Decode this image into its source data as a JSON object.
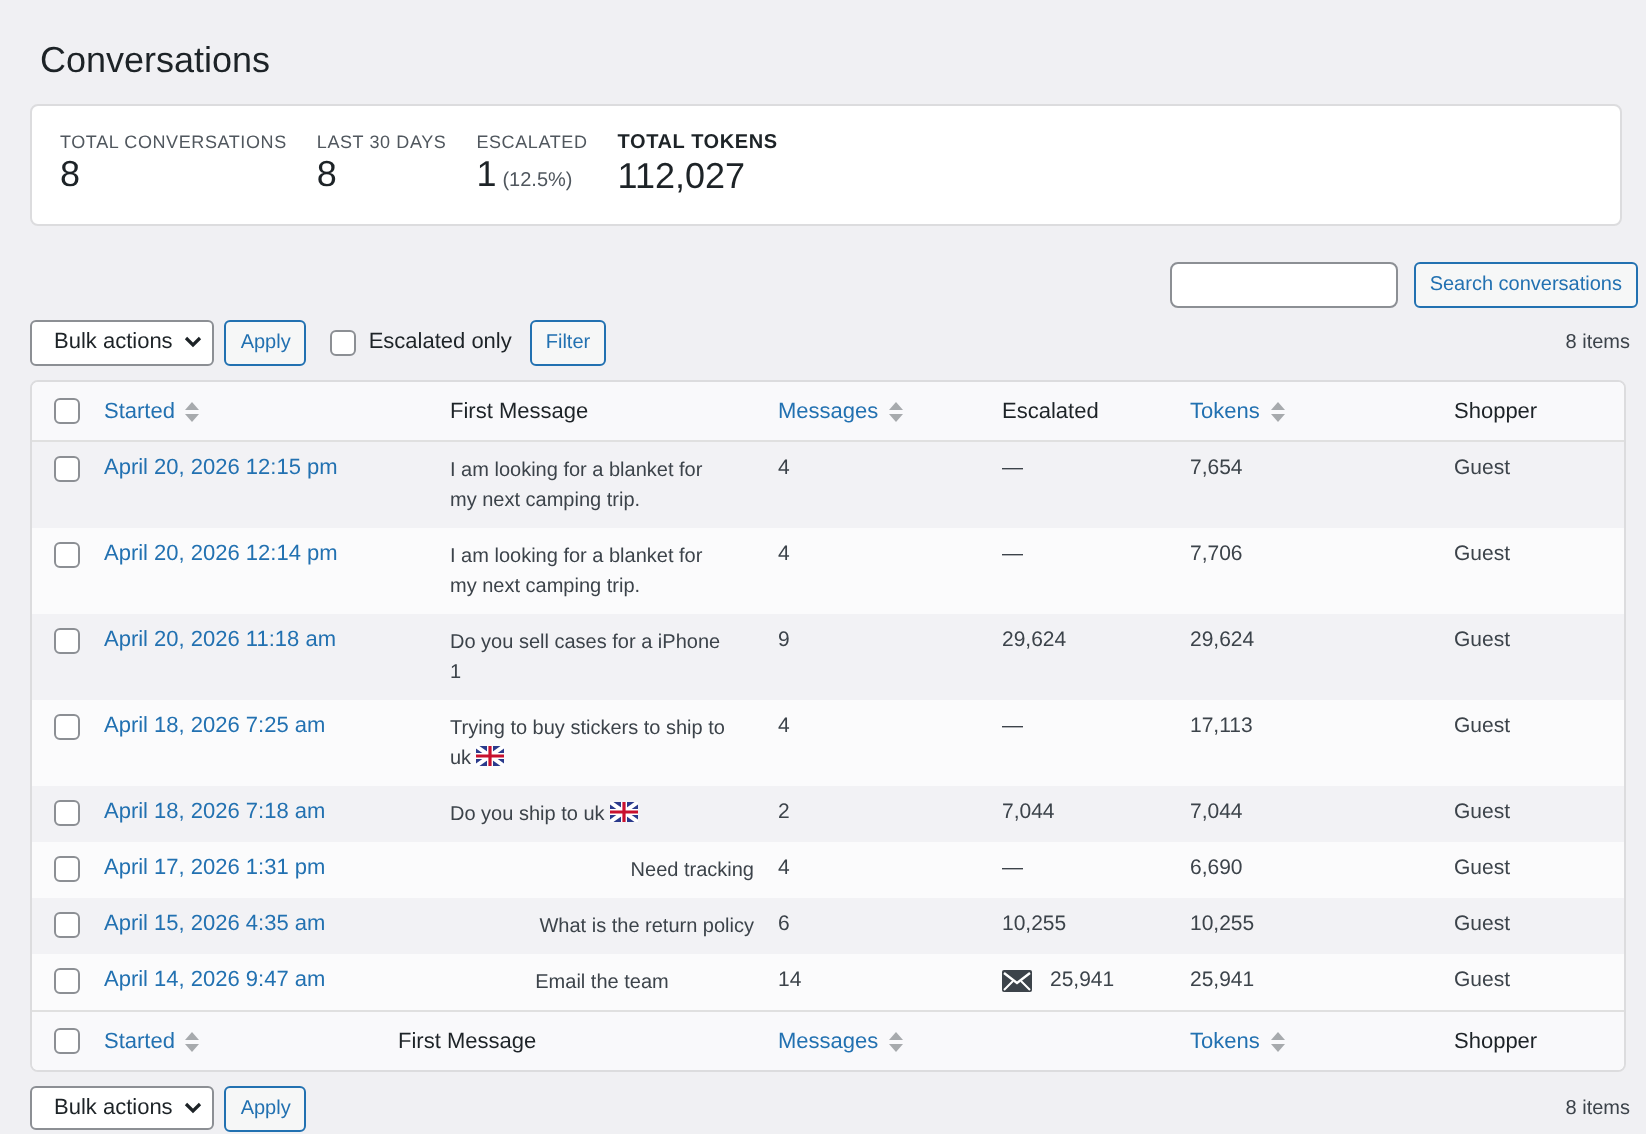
{
  "page_title": "Conversations",
  "stats": [
    {
      "label": "TOTAL CONVERSATIONS",
      "value": "8",
      "emphasized": false
    },
    {
      "label": "LAST 30 DAYS",
      "value": "8",
      "emphasized": false
    },
    {
      "label": "ESCALATED",
      "value": "1",
      "note": "(12.5%)",
      "emphasized": false
    },
    {
      "label": "TOTAL TOKENS",
      "value": "112,027",
      "emphasized": true
    }
  ],
  "search": {
    "button": "Search conversations"
  },
  "top_nav": {
    "bulk_actions": "Bulk actions",
    "apply": "Apply",
    "escalated_only": {
      "label": "Escalated only",
      "checked": false
    },
    "filter": "Filter",
    "count": "8 items"
  },
  "table": {
    "select_all_checked": false,
    "columns": [
      {
        "label": "Started",
        "sortable": true
      },
      {
        "label": "First Message",
        "sortable": false
      },
      {
        "label": "Messages",
        "sortable": true
      },
      {
        "label": "Escalated",
        "sortable": false
      },
      {
        "label": "Tokens",
        "sortable": true
      },
      {
        "label": "Shopper",
        "sortable": false
      }
    ],
    "rows": [
      {
        "checked": false,
        "started": "April 20, 2026 12:15 pm",
        "first_message": {
          "text": "I am looking for a blanket for my next camping trip.",
          "kind": "plain"
        },
        "messages": "4",
        "escalated": {
          "text": "—",
          "kind": "plain"
        },
        "tokens": "7,654",
        "shopper": "Guest"
      },
      {
        "checked": false,
        "started": "April 20, 2026 12:14 pm",
        "first_message": {
          "text": "I am looking for a blanket for my next camping trip.",
          "kind": "plain"
        },
        "messages": "4",
        "escalated": {
          "text": "—",
          "kind": "plain"
        },
        "tokens": "7,706",
        "shopper": "Guest"
      },
      {
        "checked": false,
        "started": "April 20, 2026 11:18 am",
        "first_message": {
          "text": "Do you sell cases for a iPhone 1",
          "kind": "plain"
        },
        "messages": "9",
        "escalated": {
          "text": "29,624",
          "kind": "plain"
        },
        "tokens": "29,624",
        "shopper": "Guest"
      },
      {
        "checked": false,
        "started": "April 18, 2026 7:25 am",
        "first_message": {
          "text": "Trying to buy stickers to ship to uk",
          "kind": "flagged"
        },
        "messages": "4",
        "escalated": {
          "text": "—",
          "kind": "plain"
        },
        "tokens": "17,113",
        "shopper": "Guest"
      },
      {
        "checked": false,
        "started": "April 18, 2026 7:18 am",
        "first_message": {
          "text": "Do you ship to uk",
          "kind": "flagged"
        },
        "messages": "2",
        "escalated": {
          "text": "7,044",
          "kind": "plain"
        },
        "tokens": "7,044",
        "shopper": "Guest"
      },
      {
        "checked": false,
        "started": "April 17, 2026 1:31 pm",
        "first_message": {
          "text": "Need tracking",
          "kind": "plain"
        },
        "messages": "4",
        "escalated": {
          "text": "—",
          "kind": "plain"
        },
        "tokens": "6,690",
        "shopper": "Guest"
      },
      {
        "checked": false,
        "started": "April 15, 2026 4:35 am",
        "first_message": {
          "text": "What is the return policy",
          "kind": "plain"
        },
        "messages": "6",
        "escalated": {
          "text": "10,255",
          "kind": "plain"
        },
        "tokens": "10,255",
        "shopper": "Guest"
      },
      {
        "checked": false,
        "started": "April 14, 2026 9:47 am",
        "first_message": {
          "text": "Email the team",
          "kind": "plain"
        },
        "messages": "14",
        "escalated": {
          "text": "25,941",
          "kind": "mailed"
        },
        "tokens": "25,941",
        "shopper": "Guest"
      }
    ],
    "footer_checked": false,
    "footer_columns": [
      {
        "label": "Started",
        "kind": "sortable"
      },
      {
        "label": "First Message",
        "kind": "plain"
      },
      {
        "label": "Messages",
        "kind": "sortable"
      },
      {
        "kind": "empty"
      },
      {
        "label": "Tokens",
        "kind": "sortable"
      },
      {
        "label": "Shopper",
        "kind": "plain"
      }
    ]
  },
  "bottom_nav": {
    "bulk_actions": "Bulk actions",
    "apply": "Apply",
    "count": "8 items"
  }
}
